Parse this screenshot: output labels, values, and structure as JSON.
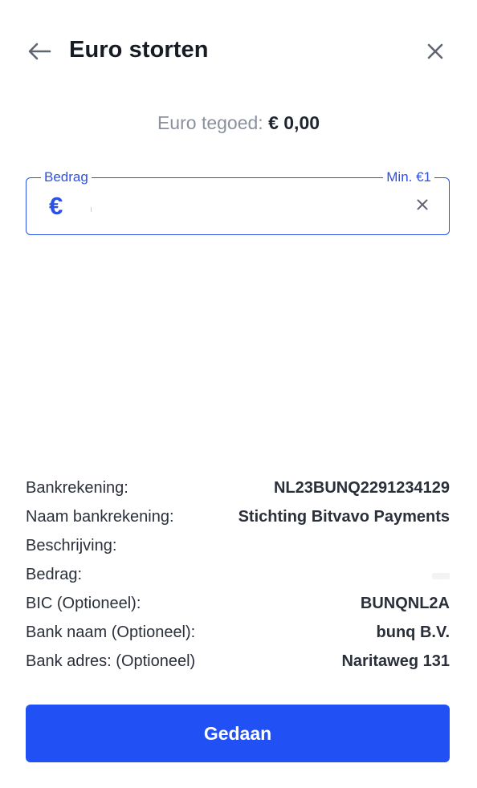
{
  "header": {
    "title": "Euro storten",
    "back_icon": "arrow-left-icon",
    "close_icon": "close-icon"
  },
  "balance": {
    "label": "Euro tegoed:",
    "value": "€ 0,00"
  },
  "amount": {
    "legend_left": "Bedrag",
    "legend_right": "Min. €1",
    "currency_symbol": "€",
    "value": "",
    "placeholder": "",
    "clear_icon": "clear-icon"
  },
  "details": [
    {
      "label": "Bankrekening:",
      "value": "NL23BUNQ2291234129"
    },
    {
      "label": "Naam bankrekening:",
      "value": "Stichting Bitvavo Payments"
    },
    {
      "label": "Beschrijving:",
      "value": ""
    },
    {
      "label": "Bedrag:",
      "value": ""
    },
    {
      "label": "BIC (Optioneel):",
      "value": "BUNQNL2A"
    },
    {
      "label": "Bank naam (Optioneel):",
      "value": "bunq B.V."
    },
    {
      "label": "Bank adres: (Optioneel)",
      "value": "Naritaweg 131"
    }
  ],
  "actions": {
    "done_label": "Gedaan"
  },
  "colors": {
    "accent": "#2150f5",
    "field_border": "#2b50e8",
    "muted_text": "#8a909c",
    "text": "#1f2530"
  }
}
